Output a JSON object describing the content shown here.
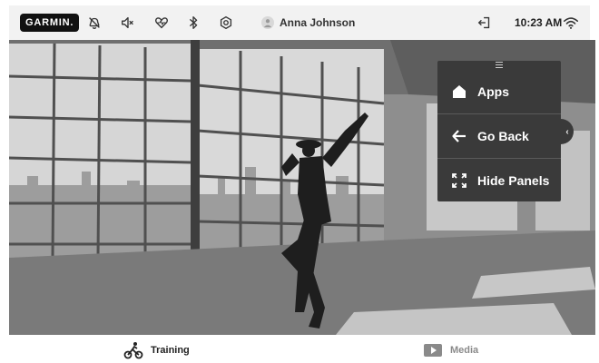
{
  "status_bar": {
    "logo_text": "GARMIN.",
    "icons": [
      "dnd-bell-icon",
      "mute-icon",
      "heart-rate-icon",
      "bluetooth-icon",
      "settings-icon"
    ],
    "user_name": "Anna Johnson",
    "exit_icon": "exit-icon",
    "time": "10:23 AM",
    "wifi_icon": "wifi-icon"
  },
  "photo": {
    "subject": "dancer-image"
  },
  "menu": {
    "handle_icon": "drag-handle-icon",
    "items": [
      {
        "label": "Apps",
        "icon": "home-icon"
      },
      {
        "label": "Go Back",
        "icon": "arrow-left-icon"
      },
      {
        "label": "Hide Panels",
        "icon": "expand-icon"
      }
    ],
    "toggle_glyph": "‹"
  },
  "bottom_nav": {
    "tabs": [
      {
        "label": "Training",
        "icon": "cycling-icon"
      },
      {
        "label": "Media",
        "icon": "play-icon"
      }
    ]
  },
  "colors": {
    "panel_bg": "#3a3a3a",
    "status_bg": "#f2f2f2",
    "media_label": "#8a8a8a"
  }
}
